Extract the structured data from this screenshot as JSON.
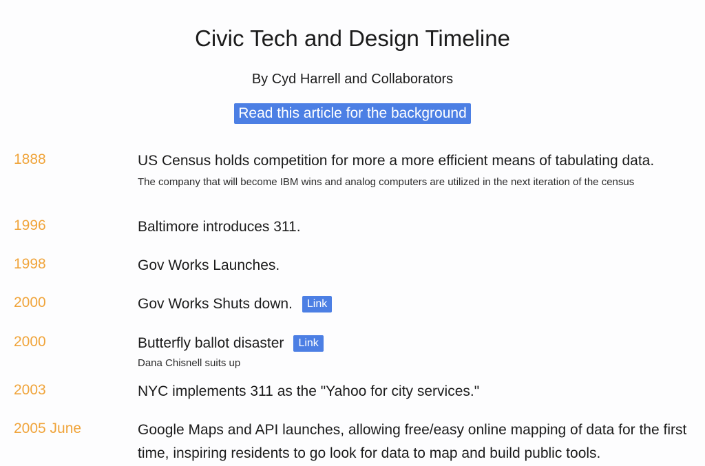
{
  "page": {
    "title": "Civic Tech and Design Timeline",
    "byline": "By Cyd Harrell and Collaborators",
    "background_link": "Read this article for the background"
  },
  "colors": {
    "year": "#f0a43a",
    "link_background": "#4c7fe4",
    "page_background": "#fdfdfe"
  },
  "timeline": [
    {
      "year": "1888",
      "headline": "US Census holds competition for more a more efficient means of tabulating data.",
      "detail": "The company that will become IBM wins and analog computers are utilized in the next iteration of the census"
    },
    {
      "year": "1996",
      "headline": "Baltimore introduces 311."
    },
    {
      "year": "1998",
      "headline": "Gov Works Launches."
    },
    {
      "year": "2000",
      "headline": "Gov Works Shuts down.",
      "link": "Link"
    },
    {
      "year": "2000",
      "headline": "Butterfly ballot disaster",
      "link": "Link",
      "detail": "Dana Chisnell suits up"
    },
    {
      "year": "2003",
      "headline": "NYC implements 311 as the \"Yahoo for city services.\""
    },
    {
      "year": "2005 June",
      "headline": "Google Maps and API launches, allowing free/easy online mapping of data for the first time, inspiring residents to go look for data to map and build public tools."
    }
  ]
}
